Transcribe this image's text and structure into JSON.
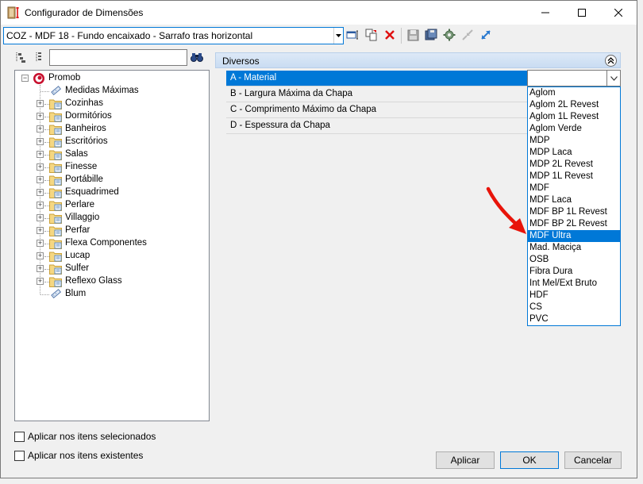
{
  "window": {
    "title": "Configurador de Dimensões"
  },
  "toolbar": {
    "combo_value": "COZ - MDF 18 - Fundo encaixado - Sarrafo tras horizontal"
  },
  "tree": {
    "search_value": "",
    "root": "Promob",
    "items": [
      {
        "label": "Medidas Máximas",
        "expandable": false,
        "icon": "ruler-icon"
      },
      {
        "label": "Cozinhas",
        "expandable": true,
        "icon": "folder-icon"
      },
      {
        "label": "Dormitórios",
        "expandable": true,
        "icon": "folder-icon"
      },
      {
        "label": "Banheiros",
        "expandable": true,
        "icon": "folder-icon"
      },
      {
        "label": "Escritórios",
        "expandable": true,
        "icon": "folder-icon"
      },
      {
        "label": "Salas",
        "expandable": true,
        "icon": "folder-icon"
      },
      {
        "label": "Finesse",
        "expandable": true,
        "icon": "folder-icon"
      },
      {
        "label": "Portábille",
        "expandable": true,
        "icon": "folder-icon"
      },
      {
        "label": "Esquadrimed",
        "expandable": true,
        "icon": "folder-icon"
      },
      {
        "label": "Perlare",
        "expandable": true,
        "icon": "folder-icon"
      },
      {
        "label": "Villaggio",
        "expandable": true,
        "icon": "folder-icon"
      },
      {
        "label": "Perfar",
        "expandable": true,
        "icon": "folder-icon"
      },
      {
        "label": "Flexa Componentes",
        "expandable": true,
        "icon": "folder-icon"
      },
      {
        "label": "Lucap",
        "expandable": true,
        "icon": "folder-icon"
      },
      {
        "label": "Sulfer",
        "expandable": true,
        "icon": "folder-icon"
      },
      {
        "label": "Reflexo Glass",
        "expandable": true,
        "icon": "folder-icon"
      },
      {
        "label": "Blum",
        "expandable": false,
        "icon": "ruler-icon"
      }
    ]
  },
  "options": {
    "apply_selected": "Aplicar nos itens selecionados",
    "apply_existing": "Aplicar nos itens existentes"
  },
  "properties": {
    "group_title": "Diversos",
    "rows": [
      {
        "label": "A - Material",
        "selected": true
      },
      {
        "label": "B - Largura Máxima da Chapa",
        "selected": false
      },
      {
        "label": "C - Comprimento Máximo da Chapa",
        "selected": false
      },
      {
        "label": "D - Espessura da Chapa",
        "selected": false
      }
    ],
    "editor_value": "",
    "dropdown_options": [
      "Aglom",
      "Aglom 2L Revest",
      "Aglom 1L Revest",
      "Aglom Verde",
      "MDP",
      "MDP Laca",
      "MDP 2L Revest",
      "MDP 1L Revest",
      "MDF",
      "MDF Laca",
      "MDF BP 1L Revest",
      "MDF BP 2L Revest",
      "MDF Ultra",
      "Mad. Maciça",
      "OSB",
      "Fibra Dura",
      "Int Mel/Ext Bruto",
      "HDF",
      "CS",
      "PVC"
    ],
    "dropdown_selected": "MDF Ultra"
  },
  "buttons": {
    "apply": "Aplicar",
    "ok": "OK",
    "cancel": "Cancelar"
  },
  "colors": {
    "selection": "#0078d7",
    "annotation_arrow": "#e8140a"
  }
}
